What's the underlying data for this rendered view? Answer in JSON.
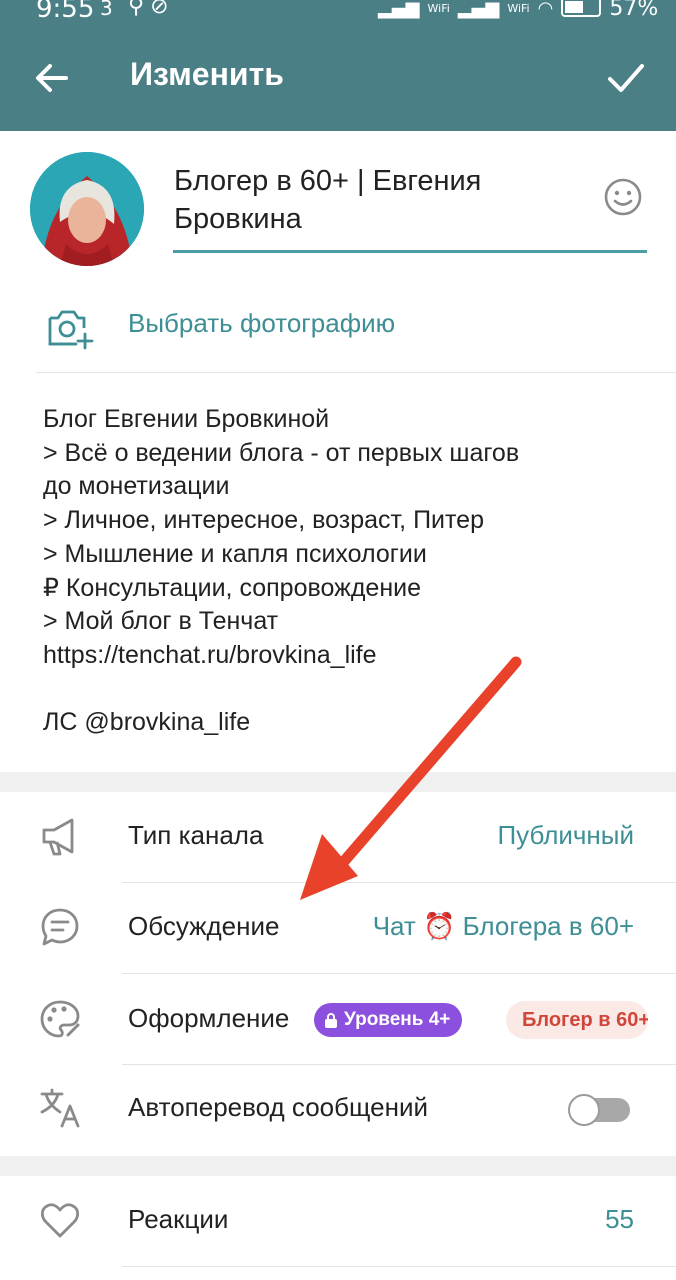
{
  "status_bar": {
    "time": "9:55",
    "sim_indicator": "3",
    "battery": "57%",
    "wifi_label_1": "WiFi",
    "wifi_label_2": "WiFi"
  },
  "app_bar": {
    "title": "Изменить",
    "back_icon": "arrow-left-icon",
    "confirm_icon": "check-icon",
    "color": "#4b7f86"
  },
  "profile": {
    "name": "Блогер в 60+ | Евгения Бровкина",
    "name_line_1": "Блогер в 60+ | Евгения",
    "name_line_2": "Бровкина",
    "choose_photo": "Выбрать фотографию"
  },
  "bio": {
    "lines": [
      "Блог Евгении Бровкиной",
      "> Всё о ведении блога - от первых шагов",
      "до монетизации",
      "> Личное, интересное, возраст, Питер",
      "> Мышление и капля психологии",
      "₽ Консультации, сопровождение",
      "> Мой блог в Тенчат",
      "https://tenchat.ru/brovkina_life",
      "",
      "ЛС @brovkina_life"
    ]
  },
  "settings": {
    "channel_type": {
      "label": "Тип канала",
      "value": "Публичный",
      "icon": "megaphone-icon"
    },
    "discussion": {
      "label": "Обсуждение",
      "value": "Чат ⏰ Блогера в 60+",
      "icon": "chat-bubble-icon"
    },
    "appearance": {
      "label": "Оформление",
      "badge": "Уровень 4+",
      "chip": "Блогер в 60+",
      "icon": "palette-icon"
    },
    "autotranslate": {
      "label": "Автоперевод сообщений",
      "enabled": false,
      "icon": "translate-icon"
    },
    "reactions": {
      "label": "Реакции",
      "value": "55",
      "icon": "heart-icon"
    }
  },
  "colors": {
    "accent": "#3d8e95",
    "badge": "#8b50de",
    "chip_text": "#d1463a",
    "annotation_arrow": "#e8422a"
  }
}
